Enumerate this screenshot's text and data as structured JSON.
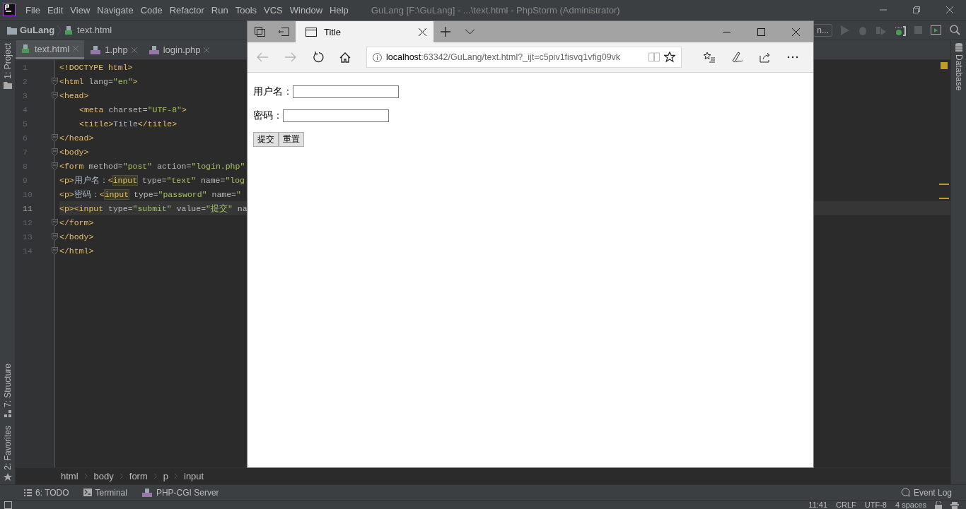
{
  "ide": {
    "title": "GuLang [F:\\GuLang] - ...\\text.html - PhpStorm (Administrator)",
    "menu": [
      "File",
      "Edit",
      "View",
      "Navigate",
      "Code",
      "Refactor",
      "Run",
      "Tools",
      "VCS",
      "Window",
      "Help"
    ],
    "breadcrumb": [
      {
        "label": "GuLang",
        "kind": "folder"
      },
      {
        "label": "text.html",
        "kind": "html"
      }
    ],
    "run_config": "n...",
    "left_top": [
      {
        "label": "1: Project",
        "kind": "folder"
      }
    ],
    "left_bottom": [
      {
        "label": "7: Structure",
        "kind": "structure"
      },
      {
        "label": "2: Favorites",
        "kind": "star"
      }
    ],
    "right_tools": [
      {
        "label": "Database",
        "kind": "database"
      }
    ],
    "tabs": [
      {
        "label": "text.html",
        "kind": "html",
        "selected": true
      },
      {
        "label": "1.php",
        "kind": "php",
        "selected": false
      },
      {
        "label": "login.php",
        "kind": "php",
        "selected": false
      }
    ],
    "code_lines": [
      {
        "number": "1",
        "fold": false,
        "current": false,
        "tokens": [
          {
            "kind": "tag",
            "text": "<!DOCTYPE html>"
          }
        ]
      },
      {
        "number": "2",
        "fold": true,
        "current": false,
        "tokens": [
          {
            "kind": "tag",
            "text": "<html"
          },
          {
            "kind": "attr",
            "text": " lang="
          },
          {
            "kind": "value",
            "text": "\"en\""
          },
          {
            "kind": "tag",
            "text": ">"
          }
        ]
      },
      {
        "number": "3",
        "fold": true,
        "current": false,
        "tokens": [
          {
            "kind": "tag",
            "text": "<head>"
          }
        ]
      },
      {
        "number": "4",
        "fold": false,
        "current": false,
        "indent": true,
        "tokens": [
          {
            "kind": "tag",
            "text": "<meta"
          },
          {
            "kind": "attr",
            "text": " charset="
          },
          {
            "kind": "value",
            "text": "\"UTF-8\""
          },
          {
            "kind": "tag",
            "text": ">"
          }
        ]
      },
      {
        "number": "5",
        "fold": false,
        "current": false,
        "indent": true,
        "tokens": [
          {
            "kind": "tag",
            "text": "<title>"
          },
          {
            "kind": "text",
            "text": "Title"
          },
          {
            "kind": "tag",
            "text": "</title>"
          }
        ]
      },
      {
        "number": "6",
        "fold": true,
        "current": false,
        "tokens": [
          {
            "kind": "tag",
            "text": "</head>"
          }
        ]
      },
      {
        "number": "7",
        "fold": true,
        "current": false,
        "tokens": [
          {
            "kind": "tag",
            "text": "<body>"
          }
        ]
      },
      {
        "number": "8",
        "fold": true,
        "current": false,
        "tokens": [
          {
            "kind": "tag",
            "text": "<form"
          },
          {
            "kind": "attr",
            "text": " method="
          },
          {
            "kind": "value",
            "text": "\"post\""
          },
          {
            "kind": "attr",
            "text": " action="
          },
          {
            "kind": "value",
            "text": "\"login.php\""
          }
        ]
      },
      {
        "number": "9",
        "fold": false,
        "current": false,
        "tokens": [
          {
            "kind": "tag",
            "text": "<p>"
          },
          {
            "kind": "text",
            "text": "用户名："
          },
          {
            "kind": "tag",
            "text": "<"
          },
          {
            "kind": "match",
            "text": "input"
          },
          {
            "kind": "attr",
            "text": " type="
          },
          {
            "kind": "value",
            "text": "\"text\""
          },
          {
            "kind": "attr",
            "text": " name="
          },
          {
            "kind": "value",
            "text": "\"log"
          }
        ]
      },
      {
        "number": "10",
        "fold": false,
        "current": false,
        "tokens": [
          {
            "kind": "tag",
            "text": "<p>"
          },
          {
            "kind": "text",
            "text": "密码："
          },
          {
            "kind": "tag",
            "text": "<"
          },
          {
            "kind": "match",
            "text": "input"
          },
          {
            "kind": "attr",
            "text": " type="
          },
          {
            "kind": "value",
            "text": "\"password\""
          },
          {
            "kind": "attr",
            "text": " name="
          },
          {
            "kind": "value",
            "text": "\""
          }
        ]
      },
      {
        "number": "11",
        "fold": false,
        "current": true,
        "tokens": [
          {
            "kind": "tag",
            "text": "<p><input"
          },
          {
            "kind": "attr",
            "text": " type="
          },
          {
            "kind": "value",
            "text": "\"submit\""
          },
          {
            "kind": "attr",
            "text": " value="
          },
          {
            "kind": "value",
            "text": "\"提交\""
          },
          {
            "kind": "attr",
            "text": " na"
          }
        ]
      },
      {
        "number": "12",
        "fold": true,
        "current": false,
        "tokens": [
          {
            "kind": "tag",
            "text": "</form>"
          }
        ]
      },
      {
        "number": "13",
        "fold": true,
        "current": false,
        "tokens": [
          {
            "kind": "tag",
            "text": "</body>"
          }
        ]
      },
      {
        "number": "14",
        "fold": true,
        "current": false,
        "tokens": [
          {
            "kind": "tag",
            "text": "</html>"
          }
        ]
      }
    ],
    "path": [
      "html",
      "body",
      "form",
      "p",
      "input"
    ],
    "tool_windows": [
      {
        "label": "6: TODO",
        "kind": "list"
      },
      {
        "label": "Terminal",
        "kind": "terminal"
      },
      {
        "label": "PHP-CGI Server",
        "kind": "php"
      }
    ],
    "event_log": "Event Log",
    "status": [
      "11:41",
      "CRLF",
      "UTF-8",
      "4 spaces"
    ]
  },
  "browser": {
    "tab_title": "Title",
    "nav": [
      {
        "kind": "back",
        "disabled": true
      },
      {
        "kind": "forward",
        "disabled": true
      },
      {
        "kind": "refresh",
        "disabled": false
      },
      {
        "kind": "home",
        "disabled": false
      }
    ],
    "url_host": "localhost",
    "url_rest": ":63342/GuLang/text.html?_ijt=c5piv1fisvq1vfig09vk",
    "fields": [
      {
        "label": "用户名："
      },
      {
        "label": "密码："
      }
    ],
    "buttons": [
      "提交",
      "重置"
    ]
  }
}
